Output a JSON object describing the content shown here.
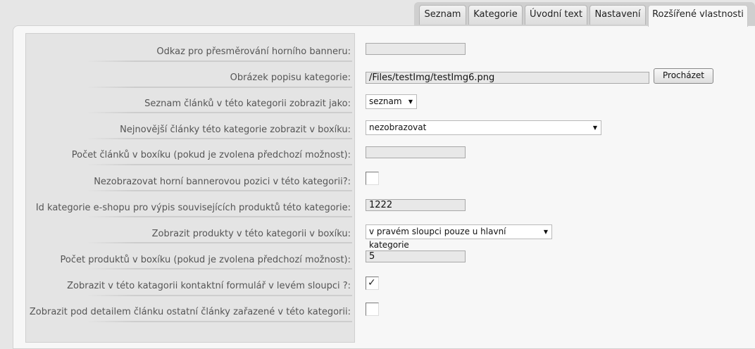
{
  "tabs": [
    {
      "label": "Seznam",
      "active": false
    },
    {
      "label": "Kategorie",
      "active": false
    },
    {
      "label": "Úvodní text",
      "active": false
    },
    {
      "label": "Nastavení",
      "active": false
    },
    {
      "label": "Rozšířené vlastnosti",
      "active": true
    }
  ],
  "form": {
    "banner_redirect": {
      "label": "Odkaz pro přesměrování horního banneru:",
      "value": ""
    },
    "category_image": {
      "label": "Obrázek popisu kategorie:",
      "value": "/Files/testImg/testImg6.png",
      "browse_label": "Procházet"
    },
    "articles_display": {
      "label": "Seznam článků v této kategorii zobrazit jako:",
      "value": "seznam"
    },
    "latest_articles_box": {
      "label": "Nejnovější články této kategorie zobrazit v boxíku:",
      "value": "nezobrazovat"
    },
    "articles_count": {
      "label": "Počet článků v boxíku (pokud je zvolena předchozí možnost):",
      "value": ""
    },
    "hide_top_banner": {
      "label": "Nezobrazovat horní bannerovou pozici v této kategorii?:",
      "checked": false
    },
    "eshop_category_id": {
      "label": "Id kategorie e-shopu pro výpis souvisejících produktů této kategorie:",
      "value": "1222"
    },
    "products_box": {
      "label": "Zobrazit produkty v této kategorii v boxíku:",
      "value": "v pravém sloupci pouze u hlavní kategorie"
    },
    "products_count": {
      "label": "Počet produktů v boxíku (pokud je zvolena předchozí možnost):",
      "value": "5"
    },
    "contact_form": {
      "label": "Zobrazit v této katagorii kontaktní formulář v levém sloupci ?:",
      "checked": true
    },
    "related_articles": {
      "label": "Zobrazit pod detailem článku ostatní články zařazené v této kategorii:",
      "checked": false
    }
  },
  "icons": {
    "dropdown": "dropdown-arrow-icon",
    "check": "checkmark-icon"
  }
}
